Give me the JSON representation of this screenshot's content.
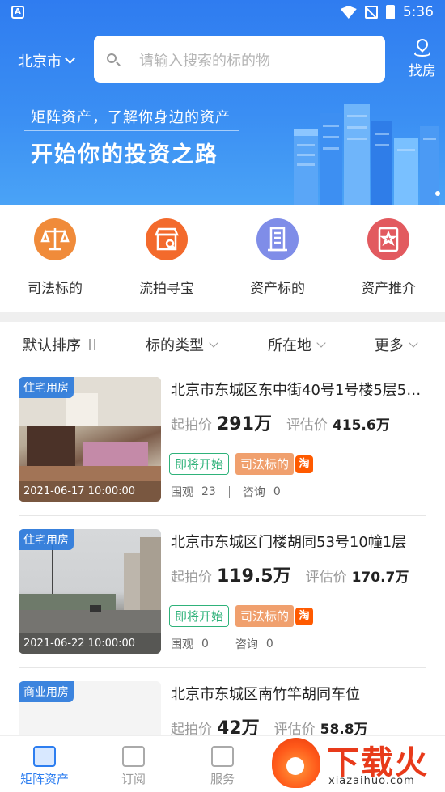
{
  "statusbar": {
    "time": "5:36",
    "app_badge": "A"
  },
  "header": {
    "city": "北京市",
    "search_placeholder": "请输入搜索的标的物",
    "find_house_label": "找房"
  },
  "banner": {
    "slogan_line1": "矩阵资产，了解你身边的资产",
    "slogan_line2": "开始你的投资之路"
  },
  "quick_entries": [
    {
      "label": "司法标的",
      "icon": "scales-icon",
      "color": "#f08b3a"
    },
    {
      "label": "流拍寻宝",
      "icon": "shop-search-icon",
      "color": "#f36a2c"
    },
    {
      "label": "资产标的",
      "icon": "building-icon",
      "color": "#7f8de8"
    },
    {
      "label": "资产推介",
      "icon": "badge-icon",
      "color": "#e25a5f"
    }
  ],
  "filters": {
    "sort": "默认排序",
    "type": "标的类型",
    "location": "所在地",
    "more": "更多"
  },
  "listings": [
    {
      "category": "住宅用房",
      "date": "2021-06-17 10:00:00",
      "title": "北京市东城区东中街40号1号楼5层5…",
      "start_label": "起拍价",
      "start_price": "291万",
      "eval_label": "评估价",
      "eval_price": "415.6万",
      "status": "即将开始",
      "source": "司法标的",
      "platform": "淘",
      "views_label": "围观",
      "views": "23",
      "consult_label": "咨询",
      "consults": "0"
    },
    {
      "category": "住宅用房",
      "date": "2021-06-22 10:00:00",
      "title": "北京市东城区门楼胡同53号10幢1层",
      "start_label": "起拍价",
      "start_price": "119.5万",
      "eval_label": "评估价",
      "eval_price": "170.7万",
      "status": "即将开始",
      "source": "司法标的",
      "platform": "淘",
      "views_label": "围观",
      "views": "0",
      "consult_label": "咨询",
      "consults": "0"
    },
    {
      "category": "商业用房",
      "date": "",
      "title": "北京市东城区南竹竿胡同车位",
      "start_label": "起拍价",
      "start_price": "42万",
      "eval_label": "评估价",
      "eval_price": "58.8万"
    }
  ],
  "bottom_nav": [
    {
      "label": "矩阵资产",
      "active": true
    },
    {
      "label": "订阅",
      "active": false
    },
    {
      "label": "服务",
      "active": false
    }
  ],
  "watermark": {
    "text": "下载火",
    "sub": "xiazaihuo.com"
  },
  "colors": {
    "primary": "#2d7ef0",
    "accent_green": "#2fb27a",
    "accent_orange": "#f0a06e"
  }
}
